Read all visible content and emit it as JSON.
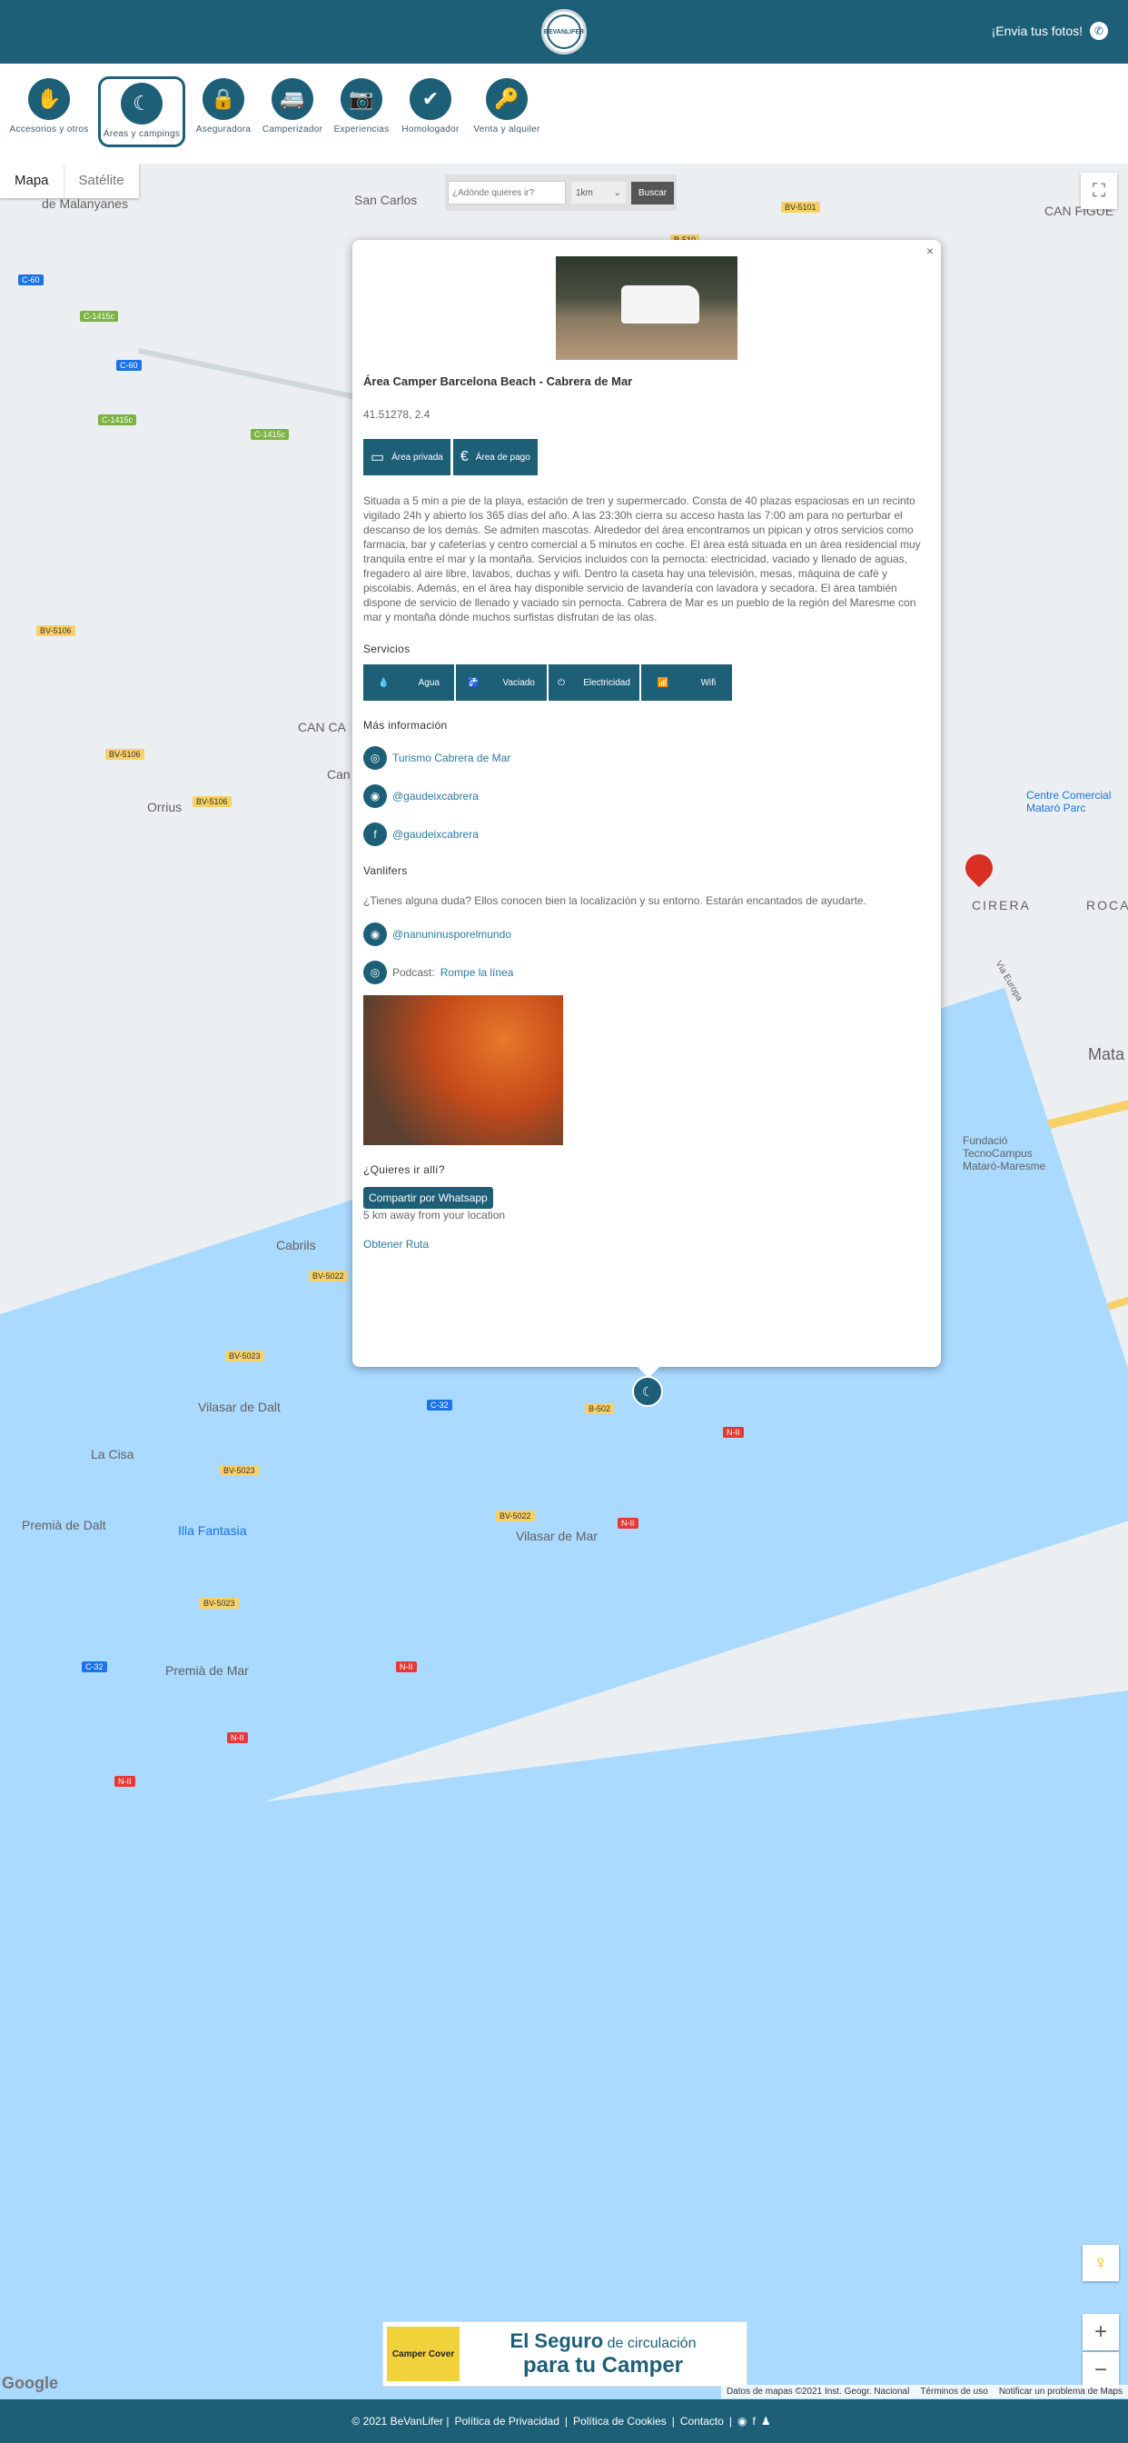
{
  "header": {
    "logo_text": "BEVANLIFER",
    "send_photos": "¡Envia tus fotos!"
  },
  "categories": [
    {
      "label": "Accesorios y otros",
      "icon": "accessories-icon"
    },
    {
      "label": "Áreas y campings",
      "icon": "moon-star-icon",
      "active": true
    },
    {
      "label": "Aseguradora",
      "icon": "lock-icon"
    },
    {
      "label": "Camperizador",
      "icon": "van-icon"
    },
    {
      "label": "Experiencias",
      "icon": "camera-icon"
    },
    {
      "label": "Homologador",
      "icon": "check-icon"
    },
    {
      "label": "Venta y alquiler",
      "icon": "key-icon"
    }
  ],
  "map": {
    "tabs": [
      "Mapa",
      "Satélite"
    ],
    "search_placeholder": "¿Adónde quieres ir?",
    "km_select": "1km",
    "search_button": "Buscar",
    "places": [
      "San Carlos",
      "de Malanyanes",
      "CAN FIGUE",
      "Orrius",
      "CAN CA",
      "Can",
      "Cabrils",
      "Vilasar de Dalt",
      "La Cisa",
      "Premià de Dalt",
      "Illa Fantasia",
      "Vilasar de Mar",
      "Premià de Mar",
      "CIRERA",
      "ROCA",
      "Mata",
      "Centre Comercial Mataró Parc",
      "Fundació TecnoCampus Mataró-Maresme",
      "Via Europa"
    ],
    "roads": [
      "C-60",
      "C-1415c",
      "C-60",
      "C-1415c",
      "C-1415c",
      "BV-5106",
      "BV-5106",
      "BV-5106",
      "B-510",
      "BV-5101",
      "BV-5022",
      "BV-5023",
      "BV-5023",
      "BV-5022",
      "C-32",
      "B-502",
      "C-32",
      "BV-5023",
      "N-II",
      "N-II",
      "N-II",
      "N-II",
      "N-II"
    ],
    "attribution": [
      "Datos de mapas ©2021 Inst. Geogr. Nacional",
      "Términos de uso",
      "Notificar un problema de Maps"
    ],
    "google": "Google"
  },
  "popup": {
    "close": "×",
    "title": "Área Camper Barcelona Beach - Cabrera de Mar",
    "coords": "41.51278, 2.4",
    "tags": [
      {
        "label": "Área privada",
        "icon": "private-icon"
      },
      {
        "label": "Área de pago",
        "icon": "euro-icon"
      }
    ],
    "description": "Situada a 5 min a pie de la playa, estación de tren y supermercado. Consta de 40 plazas espaciosas en un recinto vigilado 24h y abierto los 365 días del año. A las 23:30h cierra su acceso hasta las 7:00 am para no perturbar el descanso de los demás. Se admiten mascotas.  Alrededor del área encontramos un pipican y otros servicios como farmacia, bar y cafeterías y centro comercial a 5 minutos en coche. El área está situada en un área residencial muy tranquila entre el mar y la montaña. Servicios incluidos con la pernocta: electricidad, vaciado y llenado de aguas, fregadero al aire libre, lavabos, duchas y wifi. Dentro la caseta hay una televisión, mesas, máquina de café y piscolabis. Además, en el área hay disponible servicio de lavandería con lavadora y secadora. El área también dispone de servicio de llenado y vaciado sin pernocta. Cabrera de Mar es un pueblo de la región del Maresme con mar y montaña dónde muchos surfistas disfrutan de las olas.",
    "services_title": "Servicios",
    "services": [
      {
        "label": "Agua",
        "icon": "water-drop-icon"
      },
      {
        "label": "Vaciado",
        "icon": "tap-icon"
      },
      {
        "label": "Electricidad",
        "icon": "plug-icon"
      },
      {
        "label": "Wifi",
        "icon": "wifi-icon"
      }
    ],
    "more_info_title": "Más información",
    "more_info": [
      {
        "icon": "globe-icon",
        "text": "Turismo Cabrera de Mar"
      },
      {
        "icon": "instagram-icon",
        "text": "@gaudeixcabrera"
      },
      {
        "icon": "facebook-icon",
        "text": "@gaudeixcabrera"
      }
    ],
    "vanlifers_title": "Vanlifers",
    "vanlifers_text": "¿Tienes alguna duda? Ellos conocen bien la localización y su entorno. Estarán encantados de ayudarte.",
    "vanlifers_links": [
      {
        "icon": "instagram-icon",
        "prefix": "",
        "text": "@nanuninusporelmundo"
      },
      {
        "icon": "globe-icon",
        "prefix": "Podcast: ",
        "text": "Rompe la línea"
      }
    ],
    "go_title": "¿Quieres ir allí?",
    "whatsapp_button": "Compartir por Whatsapp",
    "distance": "5 km away from your location",
    "route_link": "Obtener Ruta"
  },
  "ad": {
    "logo": "Camper Cover",
    "line1_a": "El Seguro",
    "line1_b": " de circulación",
    "line2": "para tu Camper"
  },
  "footer": {
    "copyright": "© 2021 BeVanLifer |",
    "privacy": "Política de Privacidad",
    "sep1": "|",
    "cookies": "Política de Cookies",
    "sep2": "|",
    "contact": "Contacto",
    "sep3": "|"
  },
  "colors": {
    "primary": "#1e5f78",
    "sea": "#aadaff",
    "road": "#f7d066",
    "marker_red": "#d93025"
  }
}
